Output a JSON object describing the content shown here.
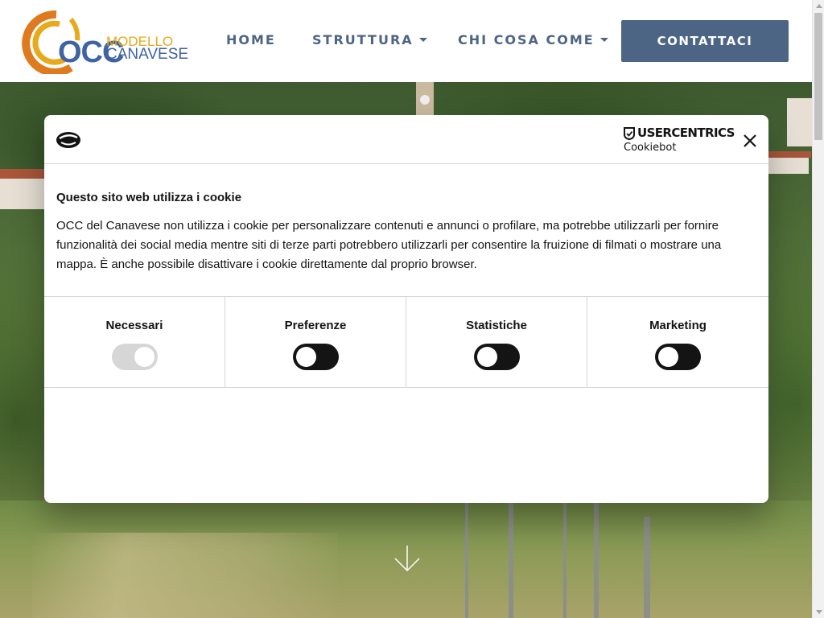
{
  "header": {
    "logo": {
      "occ": "OCC",
      "modello": "MODELLO",
      "canavese": "CANAVESE"
    },
    "nav": [
      {
        "label": "HOME",
        "dropdown": false
      },
      {
        "label": "STRUTTURA",
        "dropdown": true
      },
      {
        "label": "CHI COSA COME",
        "dropdown": true
      }
    ],
    "contact_label": "CONTATTACI"
  },
  "dialog": {
    "brand_title": "USERCENTRICS",
    "brand_sub": "Cookiebot",
    "title": "Questo sito web utilizza i cookie",
    "text": "OCC del Canavese non utilizza i cookie per personalizzare contenuti e annunci o profilare, ma potrebbe utilizzarli per fornire funzionalità dei social media mentre siti di terze parti potrebbero utilizzarli per consentire la fruizione di filmati o mostrare una mappa. È anche possibile disattivare i cookie direttamente dal proprio browser.",
    "categories": [
      {
        "label": "Necessari",
        "state": "on-disabled"
      },
      {
        "label": "Preferenze",
        "state": "off"
      },
      {
        "label": "Statistiche",
        "state": "off"
      },
      {
        "label": "Marketing",
        "state": "off"
      }
    ]
  },
  "colors": {
    "brand_blue": "#4c6584",
    "logo_blue": "#3f63a3",
    "logo_yellow": "#e8a91a",
    "logo_orange": "#e07a1e",
    "switch_dark": "#141414"
  },
  "icons": {
    "close": "close-icon",
    "scroll_down": "arrow-down-icon",
    "cookiebot": "cookiebot-logo-icon",
    "usercentrics": "shield-icon"
  }
}
